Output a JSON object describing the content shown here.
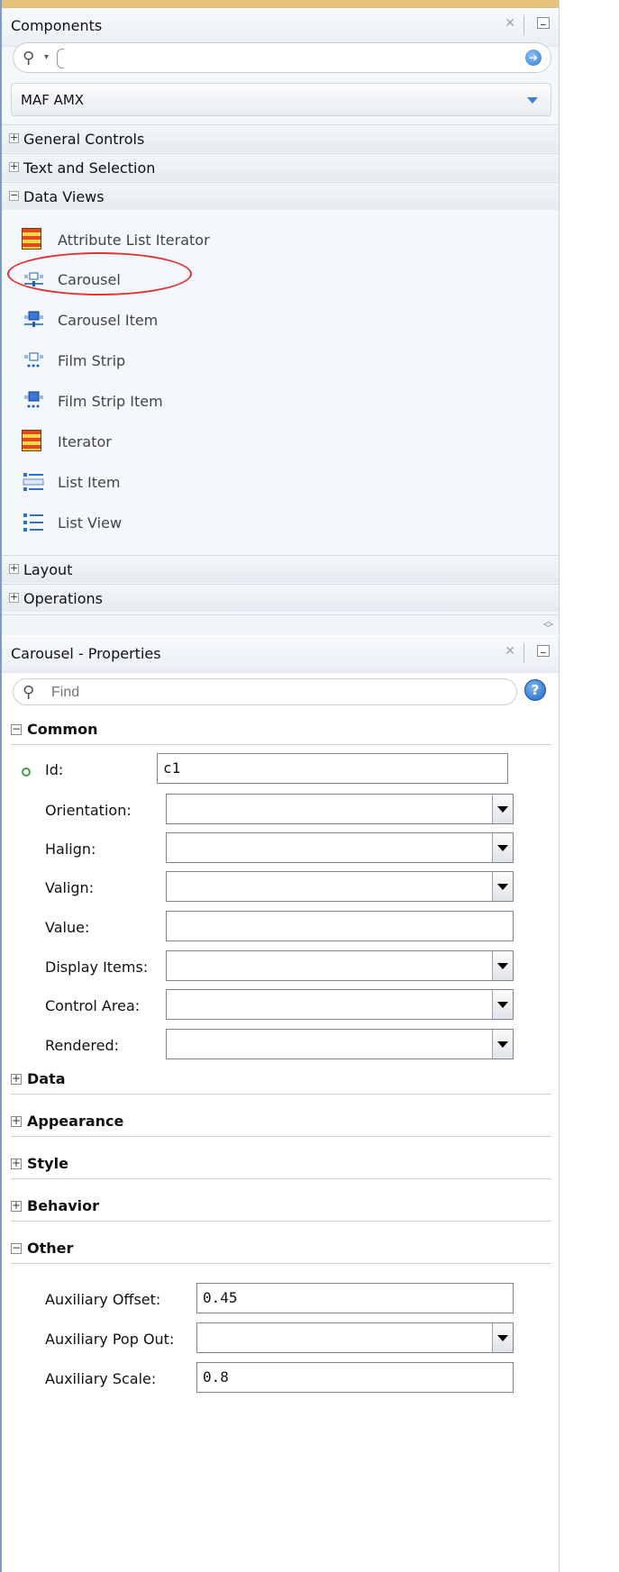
{
  "components_panel": {
    "title": "Components",
    "search": {
      "value": "",
      "placeholder": ""
    },
    "library": "MAF AMX",
    "categories": [
      {
        "label": "General Controls",
        "expanded": false
      },
      {
        "label": "Text and Selection",
        "expanded": false
      },
      {
        "label": "Data Views",
        "expanded": true
      },
      {
        "label": "Layout",
        "expanded": false
      },
      {
        "label": "Operations",
        "expanded": false
      }
    ],
    "data_views_items": [
      {
        "label": "Attribute List Iterator",
        "icon": "iterator-icon"
      },
      {
        "label": "Carousel",
        "icon": "carousel-icon"
      },
      {
        "label": "Carousel Item",
        "icon": "carousel-item-icon"
      },
      {
        "label": "Film Strip",
        "icon": "film-strip-icon"
      },
      {
        "label": "Film Strip Item",
        "icon": "film-strip-item-icon"
      },
      {
        "label": "Iterator",
        "icon": "iterator-icon"
      },
      {
        "label": "List Item",
        "icon": "list-item-icon"
      },
      {
        "label": "List View",
        "icon": "list-view-icon"
      }
    ]
  },
  "properties_panel": {
    "title": "Carousel - Properties",
    "find": {
      "value": "",
      "placeholder": "Find"
    },
    "sections": {
      "common": "Common",
      "data": "Data",
      "appearance": "Appearance",
      "style": "Style",
      "behavior": "Behavior",
      "other": "Other"
    },
    "common_fields": [
      {
        "label": "Id:",
        "value": "c1",
        "type": "text"
      },
      {
        "label": "Orientation:",
        "value": "",
        "type": "select"
      },
      {
        "label": "Halign:",
        "value": "",
        "type": "select"
      },
      {
        "label": "Valign:",
        "value": "",
        "type": "select"
      },
      {
        "label": "Value:",
        "value": "",
        "type": "text"
      },
      {
        "label": "Display Items:",
        "value": "",
        "type": "select"
      },
      {
        "label": "Control Area:",
        "value": "",
        "type": "select"
      },
      {
        "label": "Rendered:",
        "value": "",
        "type": "select"
      }
    ],
    "other_fields": [
      {
        "label": "Auxiliary Offset:",
        "value": "0.45",
        "type": "text"
      },
      {
        "label": "Auxiliary Pop Out:",
        "value": "",
        "type": "select"
      },
      {
        "label": "Auxiliary Scale:",
        "value": "0.8",
        "type": "text"
      }
    ]
  },
  "colors": {
    "highlight_ring": "#e03030",
    "panel_border": "#7a9cc6",
    "required_dot": "#3da13d"
  }
}
